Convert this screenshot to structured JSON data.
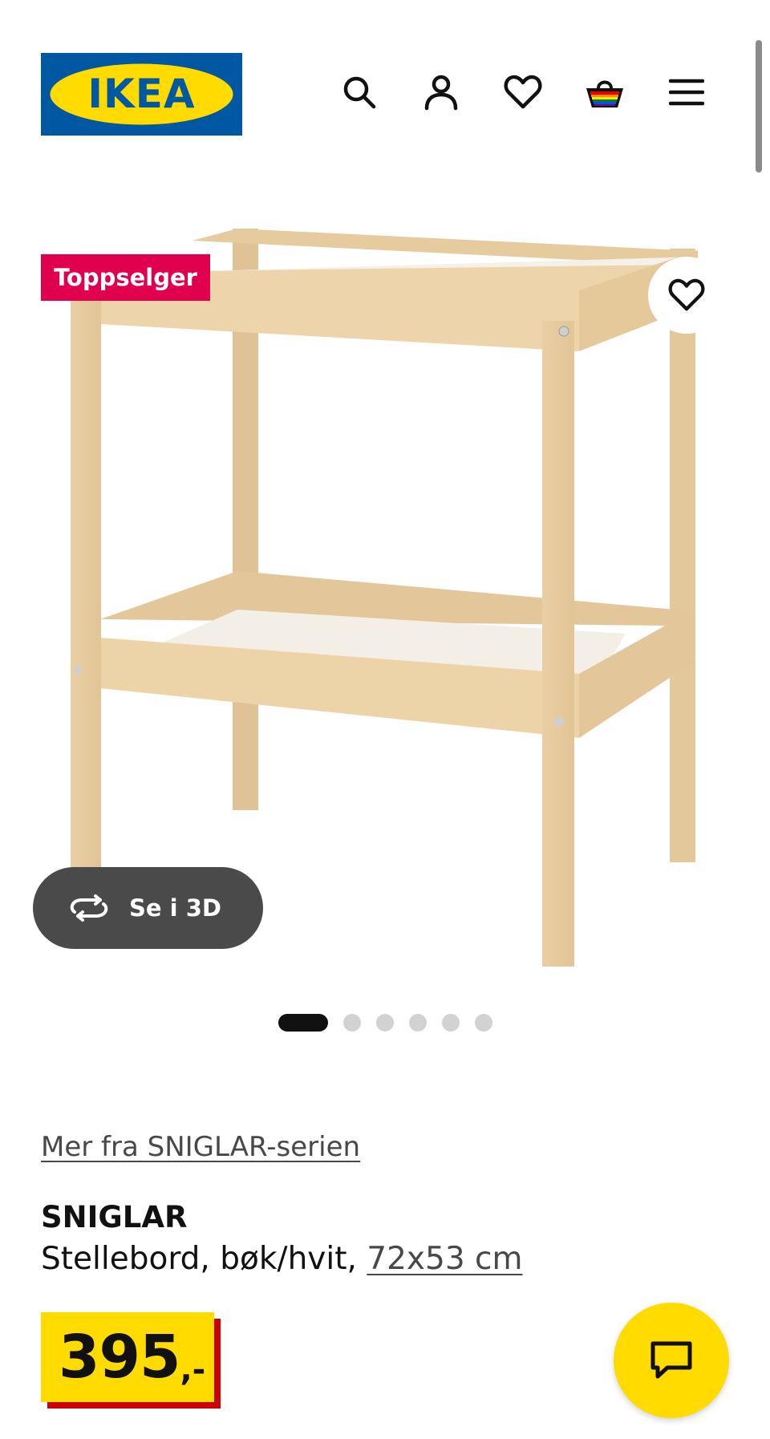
{
  "header": {
    "logo_text": "IKEA",
    "icons": [
      "search-icon",
      "account-icon",
      "heart-icon",
      "cart-icon",
      "menu-icon"
    ]
  },
  "product_image": {
    "badge": "Toppselger",
    "view_3d_label": "Se i 3D",
    "carousel": {
      "count": 6,
      "active_index": 0
    }
  },
  "product": {
    "series_link": "Mer fra SNIGLAR-serien",
    "name": "SNIGLAR",
    "description": "Stellebord, bøk/hvit,",
    "size": "72x53 cm",
    "price_main": "395",
    "price_suffix": ",-"
  },
  "colors": {
    "ikea_blue": "#0058a3",
    "ikea_yellow": "#ffdb00",
    "badge_red": "#e0004d",
    "price_shadow": "#cc0008"
  }
}
